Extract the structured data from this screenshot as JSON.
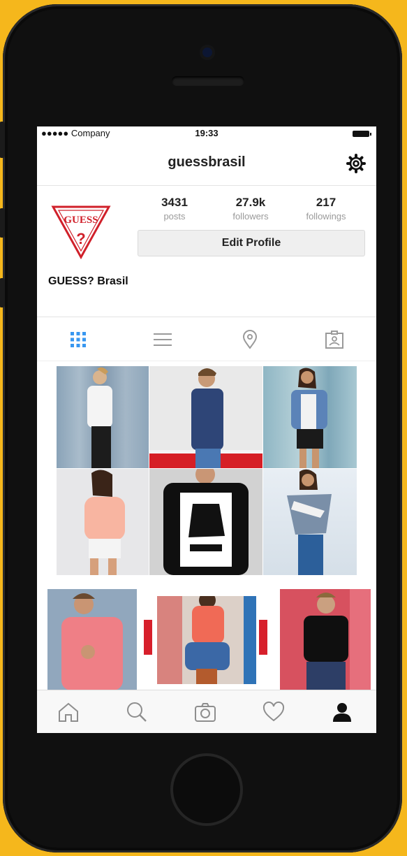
{
  "status_bar": {
    "carrier": "●●●●● Company",
    "time": "19:33"
  },
  "header": {
    "username": "guessbrasil"
  },
  "profile": {
    "display_name": "GUESS? Brasil",
    "logo_text": "GUESS",
    "stats": [
      {
        "value": "3431",
        "label": "posts"
      },
      {
        "value": "27.9k",
        "label": "followers"
      },
      {
        "value": "217",
        "label": "followings"
      }
    ],
    "edit_button": "Edit Profile"
  },
  "tabs": [
    "grid-icon",
    "list-icon",
    "location-pin-icon",
    "tagged-photo-icon"
  ],
  "bottom_nav": [
    "home-icon",
    "search-icon",
    "camera-icon",
    "heart-icon",
    "profile-icon"
  ],
  "colors": {
    "brand_red": "#d0202a",
    "background_yellow": "#f5b71c",
    "active_tab_blue": "#3897f0"
  }
}
